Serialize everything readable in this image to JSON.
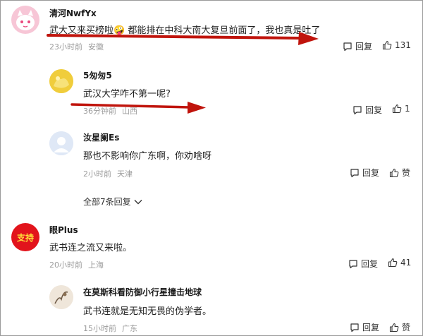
{
  "comments": [
    {
      "user": "清河NwfYx",
      "text": "武大又来买榜啦🤪 都能排在中科大南大复旦前面了，我也真是吐了",
      "time": "23小时前",
      "location": "安徽",
      "reply_label": "回复",
      "likes": "131"
    },
    {
      "user": "5匆匆5",
      "text": "武汉大学咋不第一呢?",
      "time": "36分钟前",
      "location": "山西",
      "reply_label": "回复",
      "likes": "1"
    },
    {
      "user": "汝星阑Es",
      "text": "那也不影响你广东啊，你劝啥呀",
      "time": "2小时前",
      "location": "天津",
      "reply_label": "回复",
      "likes": "赞"
    },
    {
      "user": "眼Plus",
      "text": "武书连之流又来啦。",
      "time": "20小时前",
      "location": "上海",
      "reply_label": "回复",
      "likes": "41",
      "avatar_text": "支持"
    },
    {
      "user": "在莫斯科看防御小行星撞击地球",
      "text": "武书连就是无知无畏的伪学者。",
      "time": "15小时前",
      "location": "广东",
      "reply_label": "回复",
      "likes": "赞"
    }
  ],
  "expand_replies": "全部7条回复",
  "colors": {
    "arrow": "#c0140c",
    "meta": "#9b9b9b",
    "avatar_red": "#e2141c"
  }
}
